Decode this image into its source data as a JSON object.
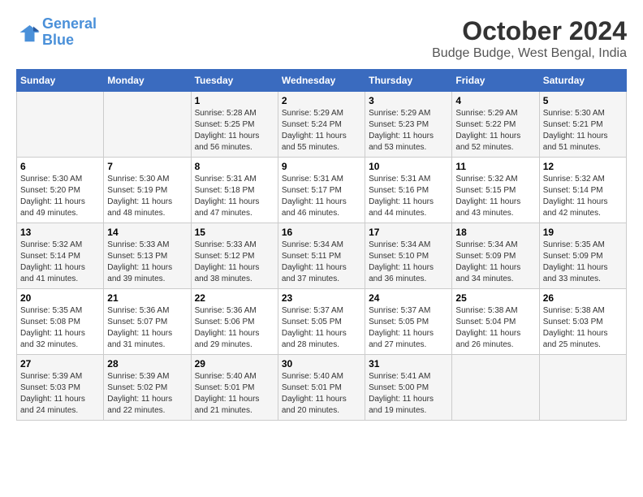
{
  "logo": {
    "line1": "General",
    "line2": "Blue"
  },
  "title": "October 2024",
  "subtitle": "Budge Budge, West Bengal, India",
  "days_of_week": [
    "Sunday",
    "Monday",
    "Tuesday",
    "Wednesday",
    "Thursday",
    "Friday",
    "Saturday"
  ],
  "weeks": [
    [
      {
        "day": "",
        "sunrise": "",
        "sunset": "",
        "daylight": ""
      },
      {
        "day": "",
        "sunrise": "",
        "sunset": "",
        "daylight": ""
      },
      {
        "day": "1",
        "sunrise": "Sunrise: 5:28 AM",
        "sunset": "Sunset: 5:25 PM",
        "daylight": "Daylight: 11 hours and 56 minutes."
      },
      {
        "day": "2",
        "sunrise": "Sunrise: 5:29 AM",
        "sunset": "Sunset: 5:24 PM",
        "daylight": "Daylight: 11 hours and 55 minutes."
      },
      {
        "day": "3",
        "sunrise": "Sunrise: 5:29 AM",
        "sunset": "Sunset: 5:23 PM",
        "daylight": "Daylight: 11 hours and 53 minutes."
      },
      {
        "day": "4",
        "sunrise": "Sunrise: 5:29 AM",
        "sunset": "Sunset: 5:22 PM",
        "daylight": "Daylight: 11 hours and 52 minutes."
      },
      {
        "day": "5",
        "sunrise": "Sunrise: 5:30 AM",
        "sunset": "Sunset: 5:21 PM",
        "daylight": "Daylight: 11 hours and 51 minutes."
      }
    ],
    [
      {
        "day": "6",
        "sunrise": "Sunrise: 5:30 AM",
        "sunset": "Sunset: 5:20 PM",
        "daylight": "Daylight: 11 hours and 49 minutes."
      },
      {
        "day": "7",
        "sunrise": "Sunrise: 5:30 AM",
        "sunset": "Sunset: 5:19 PM",
        "daylight": "Daylight: 11 hours and 48 minutes."
      },
      {
        "day": "8",
        "sunrise": "Sunrise: 5:31 AM",
        "sunset": "Sunset: 5:18 PM",
        "daylight": "Daylight: 11 hours and 47 minutes."
      },
      {
        "day": "9",
        "sunrise": "Sunrise: 5:31 AM",
        "sunset": "Sunset: 5:17 PM",
        "daylight": "Daylight: 11 hours and 46 minutes."
      },
      {
        "day": "10",
        "sunrise": "Sunrise: 5:31 AM",
        "sunset": "Sunset: 5:16 PM",
        "daylight": "Daylight: 11 hours and 44 minutes."
      },
      {
        "day": "11",
        "sunrise": "Sunrise: 5:32 AM",
        "sunset": "Sunset: 5:15 PM",
        "daylight": "Daylight: 11 hours and 43 minutes."
      },
      {
        "day": "12",
        "sunrise": "Sunrise: 5:32 AM",
        "sunset": "Sunset: 5:14 PM",
        "daylight": "Daylight: 11 hours and 42 minutes."
      }
    ],
    [
      {
        "day": "13",
        "sunrise": "Sunrise: 5:32 AM",
        "sunset": "Sunset: 5:14 PM",
        "daylight": "Daylight: 11 hours and 41 minutes."
      },
      {
        "day": "14",
        "sunrise": "Sunrise: 5:33 AM",
        "sunset": "Sunset: 5:13 PM",
        "daylight": "Daylight: 11 hours and 39 minutes."
      },
      {
        "day": "15",
        "sunrise": "Sunrise: 5:33 AM",
        "sunset": "Sunset: 5:12 PM",
        "daylight": "Daylight: 11 hours and 38 minutes."
      },
      {
        "day": "16",
        "sunrise": "Sunrise: 5:34 AM",
        "sunset": "Sunset: 5:11 PM",
        "daylight": "Daylight: 11 hours and 37 minutes."
      },
      {
        "day": "17",
        "sunrise": "Sunrise: 5:34 AM",
        "sunset": "Sunset: 5:10 PM",
        "daylight": "Daylight: 11 hours and 36 minutes."
      },
      {
        "day": "18",
        "sunrise": "Sunrise: 5:34 AM",
        "sunset": "Sunset: 5:09 PM",
        "daylight": "Daylight: 11 hours and 34 minutes."
      },
      {
        "day": "19",
        "sunrise": "Sunrise: 5:35 AM",
        "sunset": "Sunset: 5:09 PM",
        "daylight": "Daylight: 11 hours and 33 minutes."
      }
    ],
    [
      {
        "day": "20",
        "sunrise": "Sunrise: 5:35 AM",
        "sunset": "Sunset: 5:08 PM",
        "daylight": "Daylight: 11 hours and 32 minutes."
      },
      {
        "day": "21",
        "sunrise": "Sunrise: 5:36 AM",
        "sunset": "Sunset: 5:07 PM",
        "daylight": "Daylight: 11 hours and 31 minutes."
      },
      {
        "day": "22",
        "sunrise": "Sunrise: 5:36 AM",
        "sunset": "Sunset: 5:06 PM",
        "daylight": "Daylight: 11 hours and 29 minutes."
      },
      {
        "day": "23",
        "sunrise": "Sunrise: 5:37 AM",
        "sunset": "Sunset: 5:05 PM",
        "daylight": "Daylight: 11 hours and 28 minutes."
      },
      {
        "day": "24",
        "sunrise": "Sunrise: 5:37 AM",
        "sunset": "Sunset: 5:05 PM",
        "daylight": "Daylight: 11 hours and 27 minutes."
      },
      {
        "day": "25",
        "sunrise": "Sunrise: 5:38 AM",
        "sunset": "Sunset: 5:04 PM",
        "daylight": "Daylight: 11 hours and 26 minutes."
      },
      {
        "day": "26",
        "sunrise": "Sunrise: 5:38 AM",
        "sunset": "Sunset: 5:03 PM",
        "daylight": "Daylight: 11 hours and 25 minutes."
      }
    ],
    [
      {
        "day": "27",
        "sunrise": "Sunrise: 5:39 AM",
        "sunset": "Sunset: 5:03 PM",
        "daylight": "Daylight: 11 hours and 24 minutes."
      },
      {
        "day": "28",
        "sunrise": "Sunrise: 5:39 AM",
        "sunset": "Sunset: 5:02 PM",
        "daylight": "Daylight: 11 hours and 22 minutes."
      },
      {
        "day": "29",
        "sunrise": "Sunrise: 5:40 AM",
        "sunset": "Sunset: 5:01 PM",
        "daylight": "Daylight: 11 hours and 21 minutes."
      },
      {
        "day": "30",
        "sunrise": "Sunrise: 5:40 AM",
        "sunset": "Sunset: 5:01 PM",
        "daylight": "Daylight: 11 hours and 20 minutes."
      },
      {
        "day": "31",
        "sunrise": "Sunrise: 5:41 AM",
        "sunset": "Sunset: 5:00 PM",
        "daylight": "Daylight: 11 hours and 19 minutes."
      },
      {
        "day": "",
        "sunrise": "",
        "sunset": "",
        "daylight": ""
      },
      {
        "day": "",
        "sunrise": "",
        "sunset": "",
        "daylight": ""
      }
    ]
  ]
}
